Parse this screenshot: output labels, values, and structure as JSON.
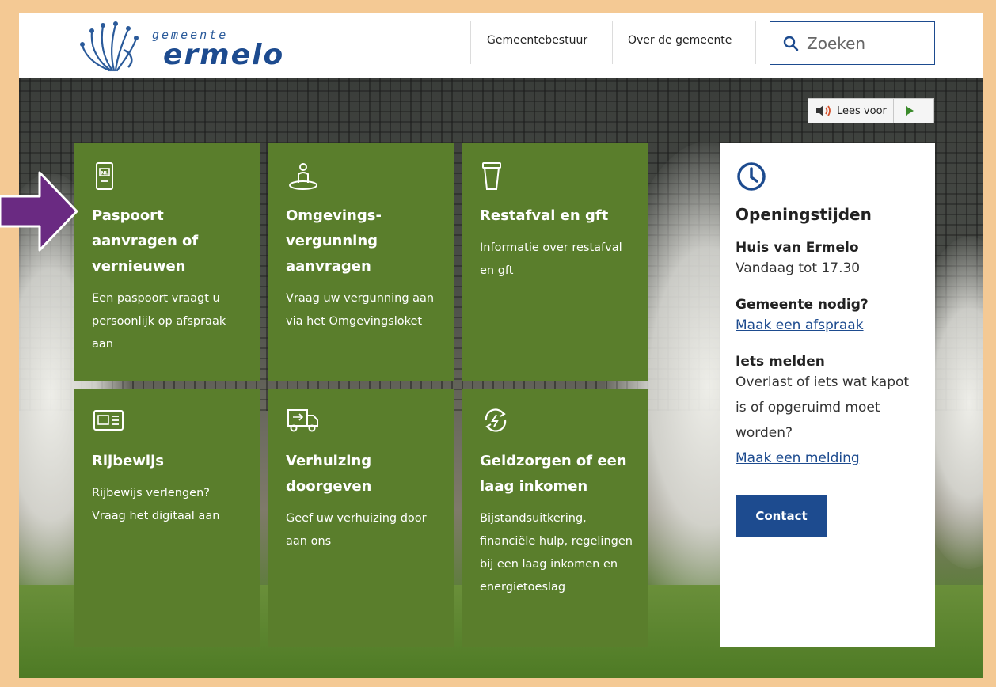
{
  "header": {
    "logo_small": "gemeente",
    "logo_big": "ermelo",
    "nav": [
      {
        "label": "Gemeentebestuur"
      },
      {
        "label": "Over de gemeente"
      }
    ],
    "search": {
      "placeholder": "Zoeken"
    }
  },
  "listen": {
    "label": "Lees voor"
  },
  "tiles": [
    {
      "icon": "passport-icon",
      "title": "Paspoort aanvragen of vernieuwen",
      "text": "Een paspoort vraagt u persoonlijk op afspraak aan"
    },
    {
      "icon": "person-location-icon",
      "title": "Omgevings-vergunning aanvragen",
      "text": "Vraag uw vergunning aan via het Omgevingsloket"
    },
    {
      "icon": "trash-bin-icon",
      "title": "Restafval en gft",
      "text": "Informatie over restafval en gft"
    },
    {
      "icon": "drivers-license-icon",
      "title": "Rijbewijs",
      "text": "Rijbewijs verlengen? Vraag het digitaal aan"
    },
    {
      "icon": "moving-truck-icon",
      "title": "Verhuizing doorgeven",
      "text": "Geef uw verhuizing door aan ons"
    },
    {
      "icon": "money-cycle-icon",
      "title": "Geldzorgen of een laag inkomen",
      "text": "Bijstandsuitkering, financiële hulp, regelingen bij een laag inkomen en energietoeslag"
    }
  ],
  "hours": {
    "title": "Openingstijden",
    "location": "Huis van Ermelo",
    "today": "Vandaag tot 17.30",
    "appointment_heading": "Gemeente nodig?",
    "appointment_link": "Maak een afspraak",
    "report_heading": "Iets melden",
    "report_text": "Overlast of iets wat kapot is of opgeruimd moet worden?",
    "report_link": "Maak een melding",
    "contact_button": "Contact"
  },
  "colors": {
    "tile_green": "#5a7e2c",
    "brand_blue": "#1d4b8f",
    "annotation_arrow": "#6a2a82",
    "frame": "#f4c994"
  }
}
